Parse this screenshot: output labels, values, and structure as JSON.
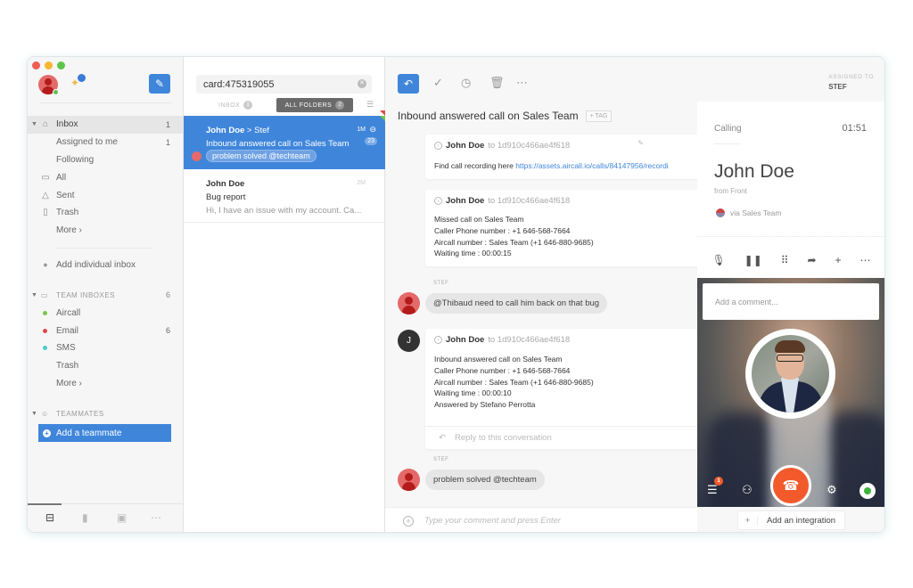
{
  "window": {
    "traffic_lights": [
      "#ee5c56",
      "#f5b731",
      "#5fc54a"
    ]
  },
  "sidebar": {
    "compose_icon": "pencil-icon",
    "inbox": {
      "label": "Inbox",
      "count": "1"
    },
    "inbox_sub": [
      {
        "label": "Assigned to me",
        "count": "1"
      },
      {
        "label": "Following",
        "count": ""
      }
    ],
    "folders": [
      {
        "label": "All",
        "icon": "archive-icon"
      },
      {
        "label": "Sent",
        "icon": "sent-icon"
      },
      {
        "label": "Trash",
        "icon": "trash-icon"
      }
    ],
    "more_label": "More ›",
    "add_individual": "Add individual inbox",
    "team_inboxes": {
      "title": "TEAM INBOXES",
      "count": "6",
      "items": [
        {
          "label": "Aircall",
          "count": "",
          "color": "#7cc44c"
        },
        {
          "label": "Email",
          "count": "6",
          "color": "#e0484b"
        },
        {
          "label": "SMS",
          "count": "",
          "color": "#4fc8d2"
        }
      ],
      "trash": "Trash",
      "more": "More ›"
    },
    "teammates": {
      "title": "TEAMMATES",
      "add": "Add a teammate"
    },
    "bottom_tabs": [
      "inbox-tray-icon",
      "analytics-icon",
      "contacts-icon",
      "more-icon"
    ]
  },
  "list": {
    "search_value": "card:475319055",
    "tabs": {
      "inbox": {
        "label": "INBOX",
        "count": "1"
      },
      "all": {
        "label": "ALL FOLDERS",
        "count": "2"
      }
    },
    "conversations": [
      {
        "from": "John Doe",
        "to": "Stef",
        "time": "1M",
        "subject": "Inbound answered call on Sales Team",
        "count": "23",
        "comment": "problem solved @techteam"
      },
      {
        "from": "John Doe",
        "time": "2M",
        "subject": "Bug report",
        "preview": "Hi, I have an issue with my account. Ca..."
      }
    ]
  },
  "main": {
    "assigned_label": "ASSIGNED TO",
    "assigned_value": "STEF",
    "subject": "Inbound answered call on Sales Team",
    "tag_label": "+ TAG",
    "messages": [
      {
        "from": "John Doe",
        "to": "to 1d910c466ae4f618",
        "lines": [],
        "link_prefix": "Find call recording here ",
        "link": "https://assets.aircall.io/calls/84147956/recordi"
      },
      {
        "from": "John Doe",
        "to": "to 1d910c466ae4f618",
        "lines": [
          "Missed call on Sales Team",
          "Caller Phone number : +1 646-568-7664",
          "Aircall number : Sales Team (+1 646-880-9685)",
          "Waiting time : 00:00:15"
        ]
      },
      {
        "from": "John Doe",
        "to": "to 1d910c466ae4f618",
        "avatar_letter": "J",
        "lines": [
          "Inbound answered call on Sales Team",
          "Caller Phone number : +1 646-568-7664",
          "Aircall number : Sales Team (+1 646-880-9685)",
          "Waiting time : 00:00:10",
          "Answered by Stefano Perrotta"
        ],
        "reply_placeholder": "Reply to this conversation"
      }
    ],
    "comments": [
      {
        "author": "STEF",
        "text": "@Thibaud need to call him back on that bug"
      },
      {
        "author": "STEF",
        "text": "problem solved @techteam"
      }
    ],
    "composer_placeholder": "Type your comment and press Enter"
  },
  "call_panel": {
    "status": "Calling",
    "timer": "01:51",
    "contact_name": "John Doe",
    "contact_source": "from Front",
    "via": "via Sales Team",
    "comment_placeholder": "Add a comment...",
    "actions": [
      "mic-icon",
      "pause-icon",
      "keypad-icon",
      "transfer-icon",
      "add-icon",
      "more-icon"
    ],
    "notification_count": "1",
    "integration_label": "Add an integration",
    "hangup_color": "#f25a2c"
  }
}
